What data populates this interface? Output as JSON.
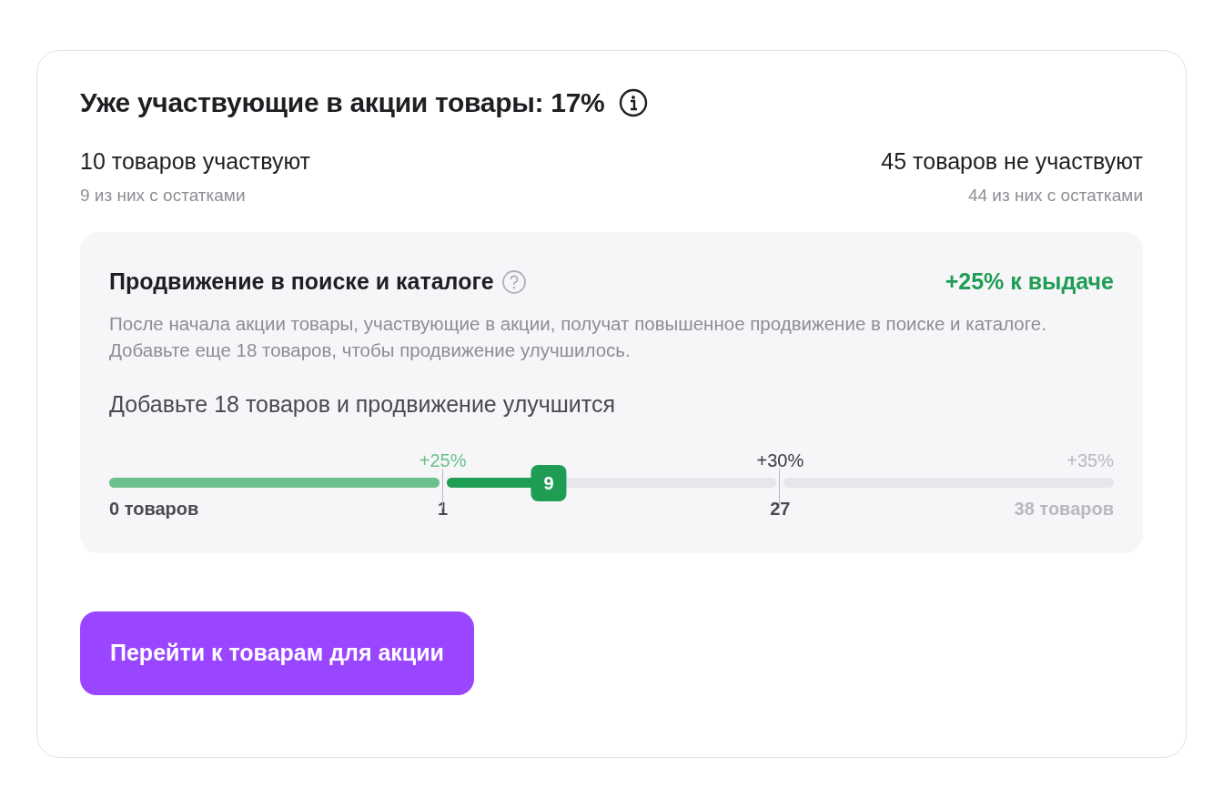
{
  "title": "Уже участвующие в акции товары: 17%",
  "stats": [
    {
      "count": "10 товаров участвуют",
      "note": "9 из них с остатками"
    },
    {
      "count": "45 товаров не участвуют",
      "note": "44 из них с остатками"
    }
  ],
  "promotion": {
    "title": "Продвижение в поиске и каталоге",
    "boost": "+25% к выдаче",
    "description": "После начала акции товары, участвующие в акции, получат повышенное продвижение в поиске и каталоге. Добавьте еще 18 товаров, чтобы продвижение улучшилось.",
    "hint": "Добавьте 18 товаров и продвижение улучшится",
    "start_label": "0 товаров",
    "segments": [
      {
        "kind": "done",
        "level": 1,
        "top_label": "+25%",
        "end_label": "1"
      },
      {
        "kind": "current",
        "level": 0.31,
        "top_label": "+30%",
        "end_label": "27",
        "thumb": "9"
      },
      {
        "kind": "future",
        "top_label": "+35%",
        "end_label": "38 товаров"
      }
    ]
  },
  "button": "Перейти к товарам для акции"
}
